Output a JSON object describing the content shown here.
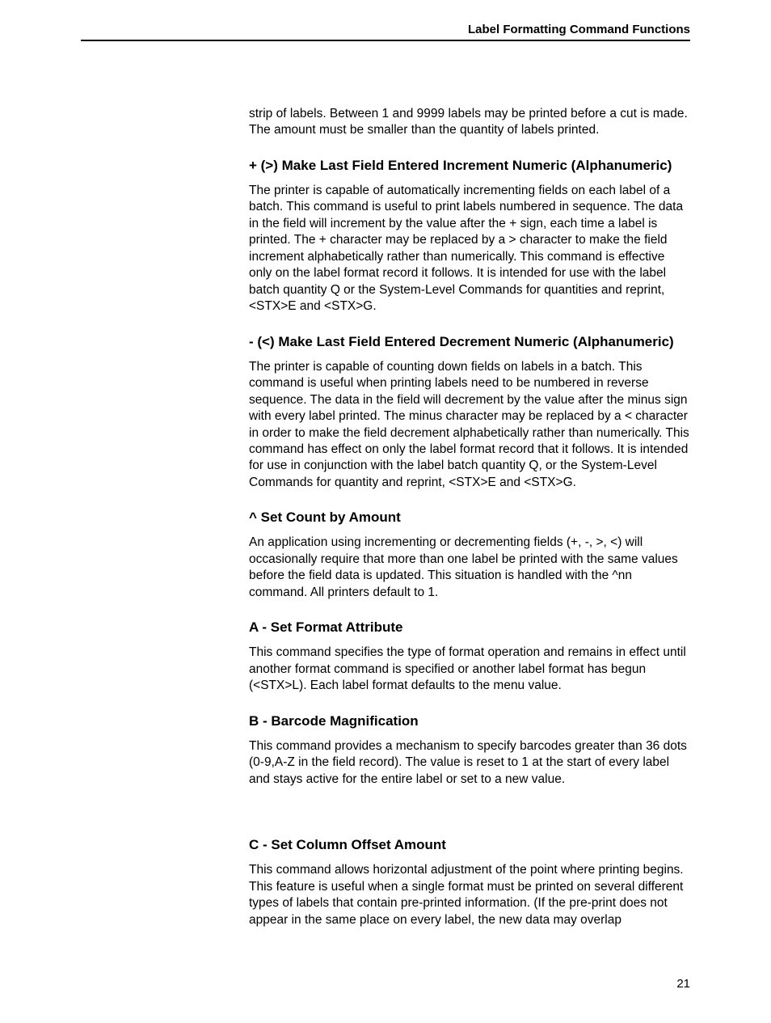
{
  "header": {
    "running_title": "Label Formatting Command Functions"
  },
  "intro": {
    "paragraph": "strip of labels. Between 1 and 9999 labels may be printed before a cut is made. The amount must be smaller than the quantity of labels printed."
  },
  "sections": [
    {
      "title": "+ (>) Make Last Field Entered Increment Numeric (Alphanumeric)",
      "body": "The printer is capable of automatically incrementing fields on each label of a batch. This command is useful to print labels numbered in sequence. The data in the field will increment by the value after the + sign, each time a label is printed. The + character may be replaced by a > character to make the field increment alphabetically rather than numerically. This command is effective only on the label format record it follows. It is intended for use with the label batch quantity Q or the System-Level Commands for quantities and reprint, <STX>E and <STX>G."
    },
    {
      "title": "- (<) Make Last Field Entered Decrement Numeric (Alphanumeric)",
      "body": "The printer is capable of counting down fields on labels in a batch. This command is useful when printing labels need to be numbered in reverse sequence. The data in the field will decrement by the value after the minus sign with every label printed. The minus character may be replaced by a < character in order to make the field decrement alphabetically rather than numerically. This command has effect on only the label format record that it follows. It is intended for use in conjunction with the label batch quantity Q, or the System-Level Commands for quantity and reprint, <STX>E and <STX>G."
    },
    {
      "title": "^ Set Count by Amount",
      "body": "An application using incrementing or decrementing fields (+, -, >, <) will occasionally require that more than one label be printed with the same values before the field data is updated. This situation is handled with the ^nn command. All printers default to 1."
    },
    {
      "title": "A - Set Format Attribute",
      "body": "This command specifies the type of format operation and remains in effect until another format command is specified or another label format has begun (<STX>L). Each label format defaults to the menu value."
    },
    {
      "title": "B - Barcode Magnification",
      "body": "This command provides a mechanism to specify barcodes greater than 36 dots (0-9,A-Z in the field record). The value is reset to 1 at the start of every label and stays active for the entire label or set to a new value."
    },
    {
      "title": "C - Set Column Offset Amount",
      "body": "This command allows horizontal adjustment of the point where printing begins. This feature is useful when a single format must be printed on several different types of labels that contain pre-printed information. (If the pre-print does not appear in the same place on every label, the new data may overlap"
    }
  ],
  "page_number": "21"
}
